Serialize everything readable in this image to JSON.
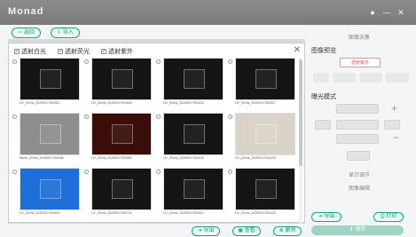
{
  "app": {
    "title": "Monad"
  },
  "toolbar": {
    "back_label": "返回",
    "import_label": "导入"
  },
  "dialog": {
    "checks": [
      "透射白光",
      "透射荧光",
      "透射紫外"
    ],
    "images": [
      {
        "caption": "UV_XDms_20250917091812",
        "tone": "dark"
      },
      {
        "caption": "UV_XDms_20250917094505",
        "tone": "dark"
      },
      {
        "caption": "UV_XDms_20250917094204",
        "tone": "dark"
      },
      {
        "caption": "UV_XDms_20250917094037",
        "tone": "dark"
      },
      {
        "caption": "White_XDms_20250917094046",
        "tone": "gray"
      },
      {
        "caption": "UV_XDms_20250917091859",
        "tone": "red"
      },
      {
        "caption": "UV_XDms_20250917094125",
        "tone": "dark"
      },
      {
        "caption": "UV_XDms_20250917094230",
        "tone": "light"
      },
      {
        "caption": "UV_XDms_20250917094903",
        "tone": "blue"
      },
      {
        "caption": "UV_XDms_20250917094734",
        "tone": "dark"
      },
      {
        "caption": "UV_XDms_20250917094902",
        "tone": "dark"
      },
      {
        "caption": "UV_XDms_20250917094325",
        "tone": "dark"
      }
    ]
  },
  "bottom": {
    "export_label": "导出",
    "view_label": "查看",
    "delete_label": "删除"
  },
  "panel": {
    "tab_capture": "图像采集",
    "preview_title": "图像预览",
    "uv_label": "透射紫外",
    "exposure_title": "曝光模式",
    "tab_display": "显示调节",
    "tab_edit": "图像编辑",
    "export_label": "导出",
    "print_label": "打印",
    "save_label": "保存"
  }
}
